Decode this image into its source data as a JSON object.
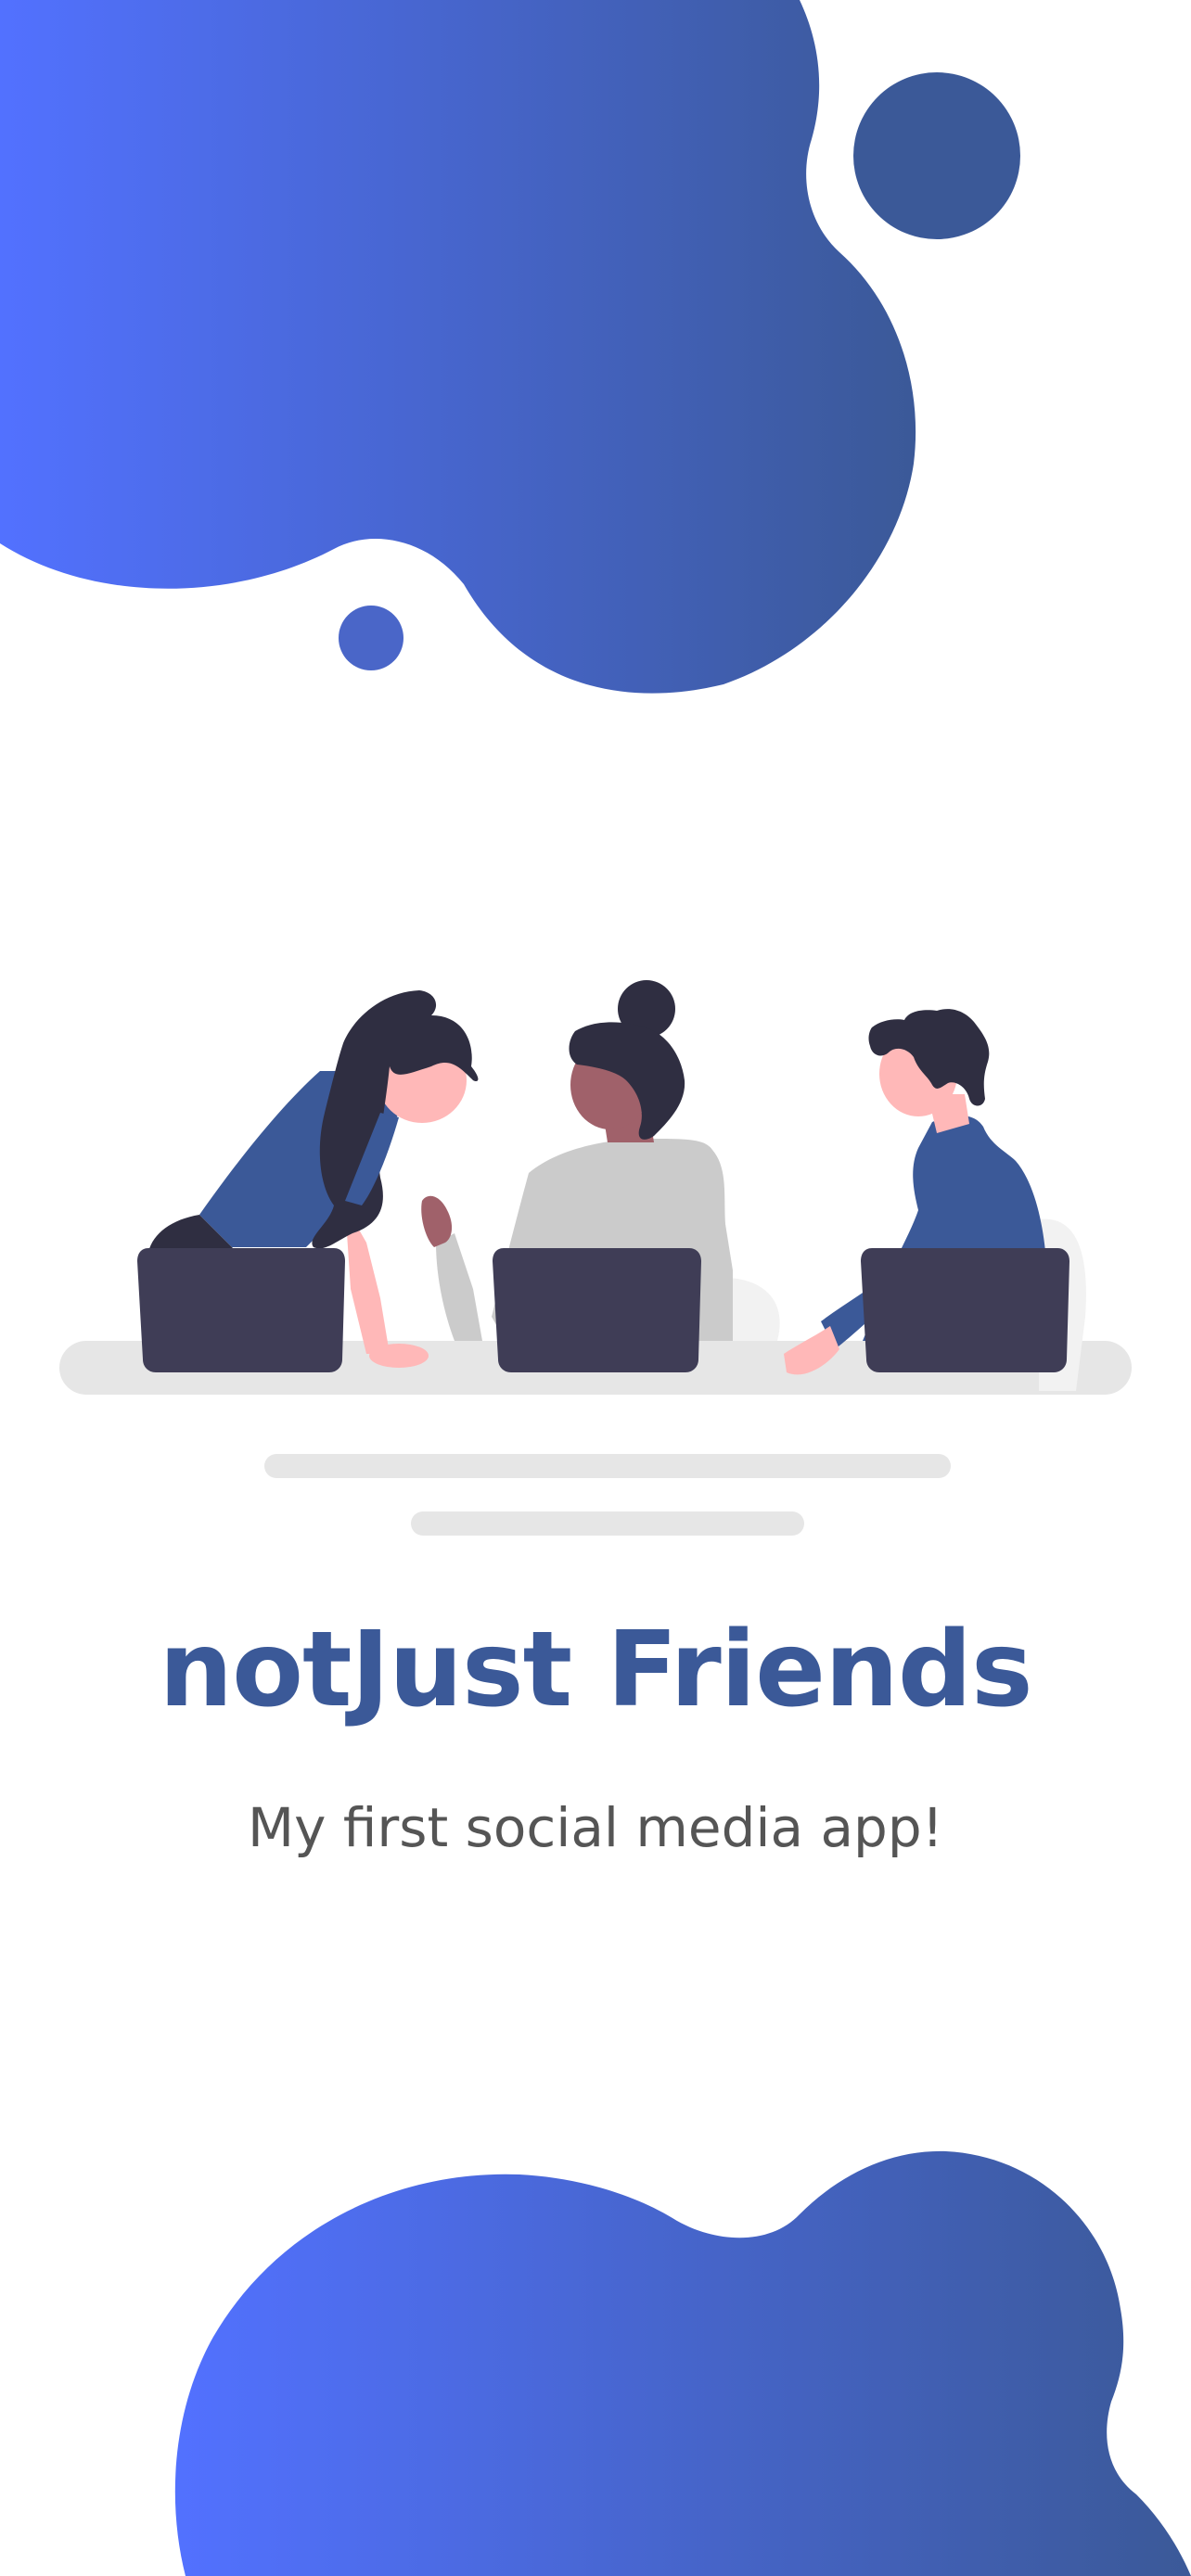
{
  "app": {
    "title": "notJust Friends",
    "subtitle": "My first social media app!"
  },
  "colors": {
    "brand_primary": "#3b5998",
    "gradient_start": "#5271ff",
    "gradient_end": "#3b5998",
    "subtitle_text": "#555555",
    "laptop": "#3f3d56",
    "desk": "#e6e6e6",
    "skin_light": "#ffb8b8",
    "skin_dark": "#a0616a",
    "hair": "#2f2e41",
    "shirt_blue": "#3b5998",
    "shirt_grey": "#cbcbcb"
  },
  "illustration": {
    "name": "team-working-on-laptops-illustration"
  }
}
